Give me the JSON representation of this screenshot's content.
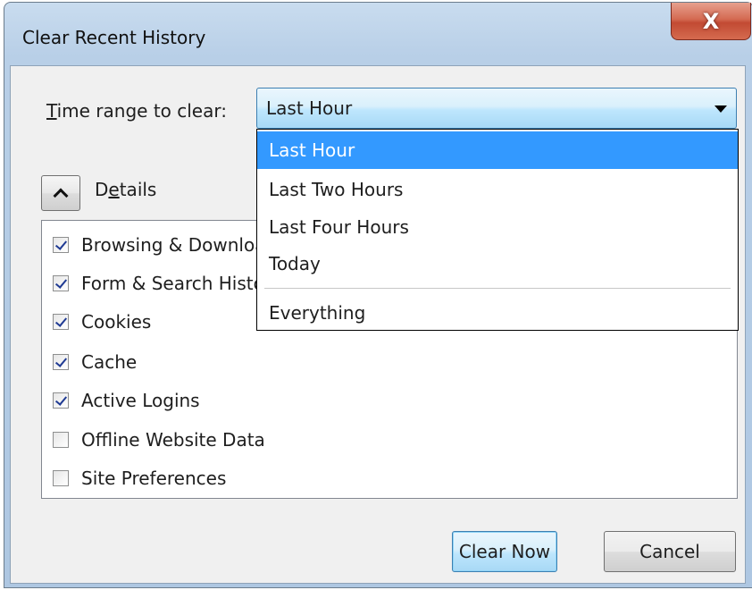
{
  "window": {
    "title": "Clear Recent History",
    "close_glyph": "X"
  },
  "time_range": {
    "label_accesskey": "T",
    "label_rest": "ime range to clear:",
    "selected": "Last Hour",
    "options": [
      "Last Hour",
      "Last Two Hours",
      "Last Four Hours",
      "Today",
      "Everything"
    ]
  },
  "details": {
    "label_pre": "D",
    "label_accesskey": "e",
    "label_rest": "tails"
  },
  "items": [
    {
      "label": "Browsing & Download History",
      "checked": true
    },
    {
      "label": "Form & Search History",
      "checked": true
    },
    {
      "label": "Cookies",
      "checked": true
    },
    {
      "label": "Cache",
      "checked": true
    },
    {
      "label": "Active Logins",
      "checked": true
    },
    {
      "label": "Offline Website Data",
      "checked": false
    },
    {
      "label": "Site Preferences",
      "checked": false
    }
  ],
  "buttons": {
    "clear_now": "Clear Now",
    "cancel": "Cancel"
  },
  "colors": {
    "selection": "#3399ff",
    "close_button": "#c24a33",
    "checkmark": "#1f3a93"
  }
}
